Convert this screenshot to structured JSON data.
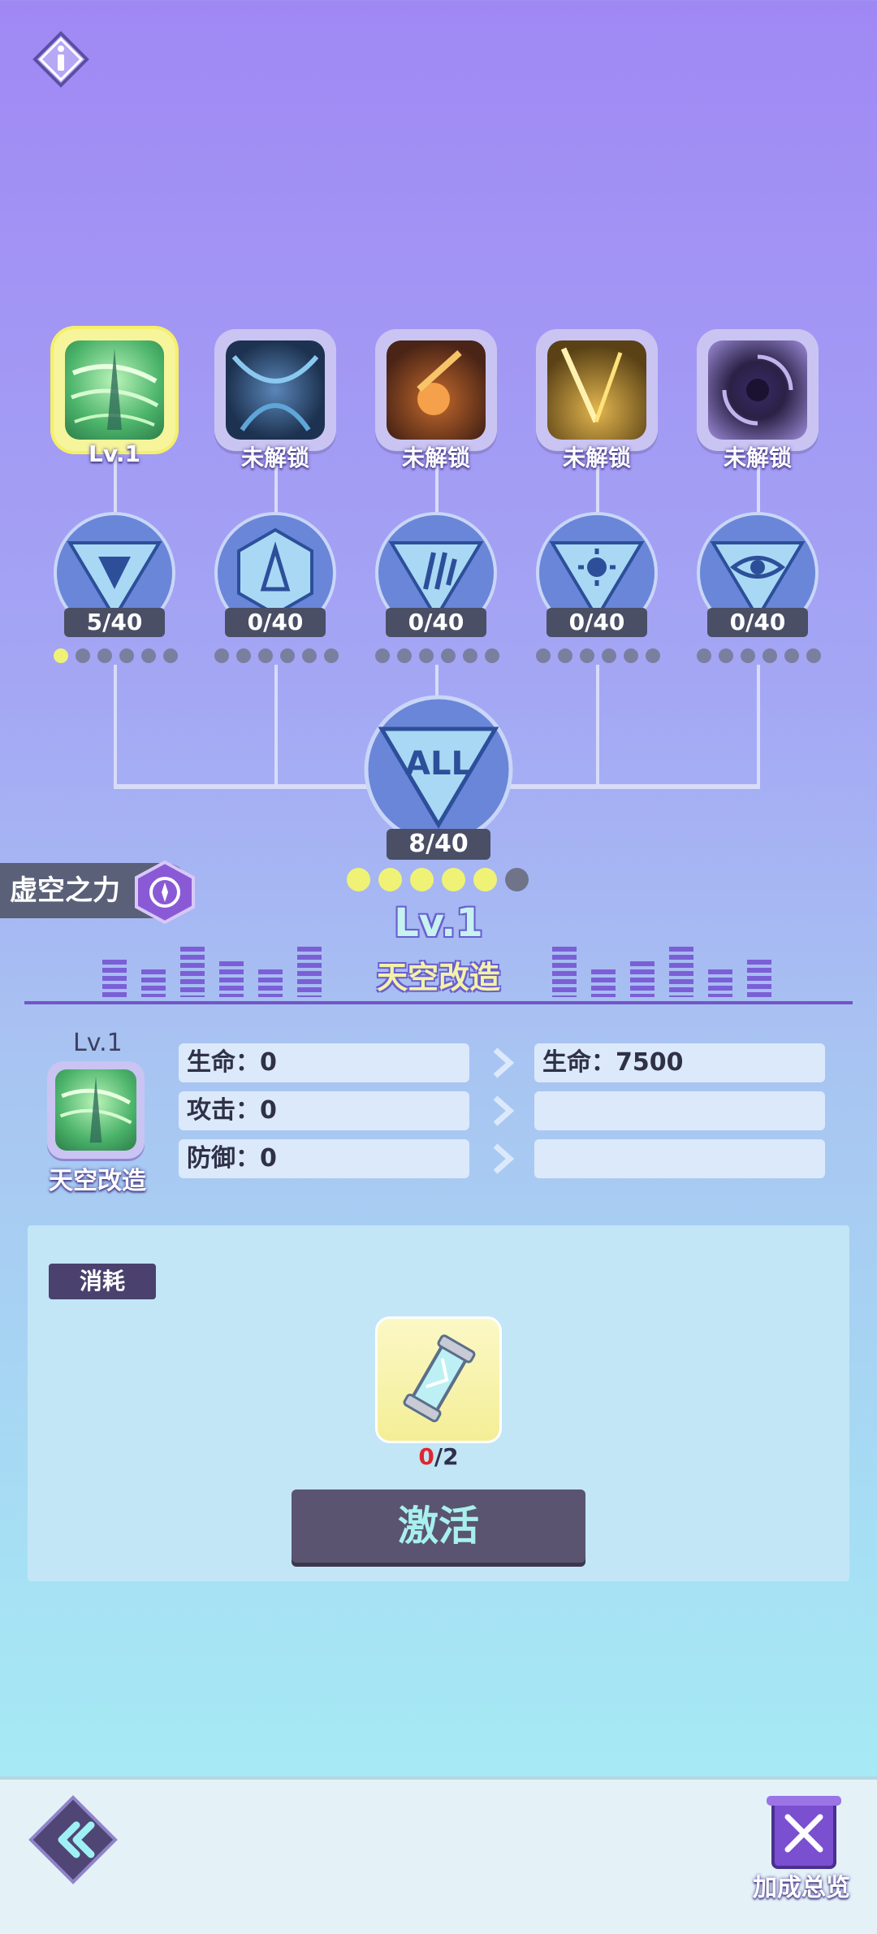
{
  "skills": [
    {
      "label": "Lv.1",
      "selected": true
    },
    {
      "label": "未解锁"
    },
    {
      "label": "未解锁"
    },
    {
      "label": "未解锁"
    },
    {
      "label": "未解锁"
    }
  ],
  "nodes": [
    {
      "count": "5/40",
      "filled": 1,
      "total": 6
    },
    {
      "count": "0/40",
      "filled": 0,
      "total": 6
    },
    {
      "count": "0/40",
      "filled": 0,
      "total": 6
    },
    {
      "count": "0/40",
      "filled": 0,
      "total": 6
    },
    {
      "count": "0/40",
      "filled": 0,
      "total": 6
    }
  ],
  "all_node": {
    "label": "ALL",
    "count": "8/40",
    "filled": 5,
    "total": 6
  },
  "void_power": {
    "label": "虚空之力"
  },
  "current": {
    "level": "Lv.1",
    "name": "天空改造"
  },
  "stats": {
    "skill_level": "Lv.1",
    "skill_name": "天空改造",
    "current": [
      "生命：0",
      "攻击：0",
      "防御：0"
    ],
    "next": [
      "生命：7500",
      "",
      ""
    ]
  },
  "cost": {
    "tag": "消耗",
    "have": "0",
    "need": "/2"
  },
  "activate_label": "激活",
  "bottom": {
    "bonus_label": "加成总览"
  },
  "colors": {
    "accent": "#7356c8",
    "dot_on": "#f0f275",
    "dot_off": "#7a7fa0"
  }
}
